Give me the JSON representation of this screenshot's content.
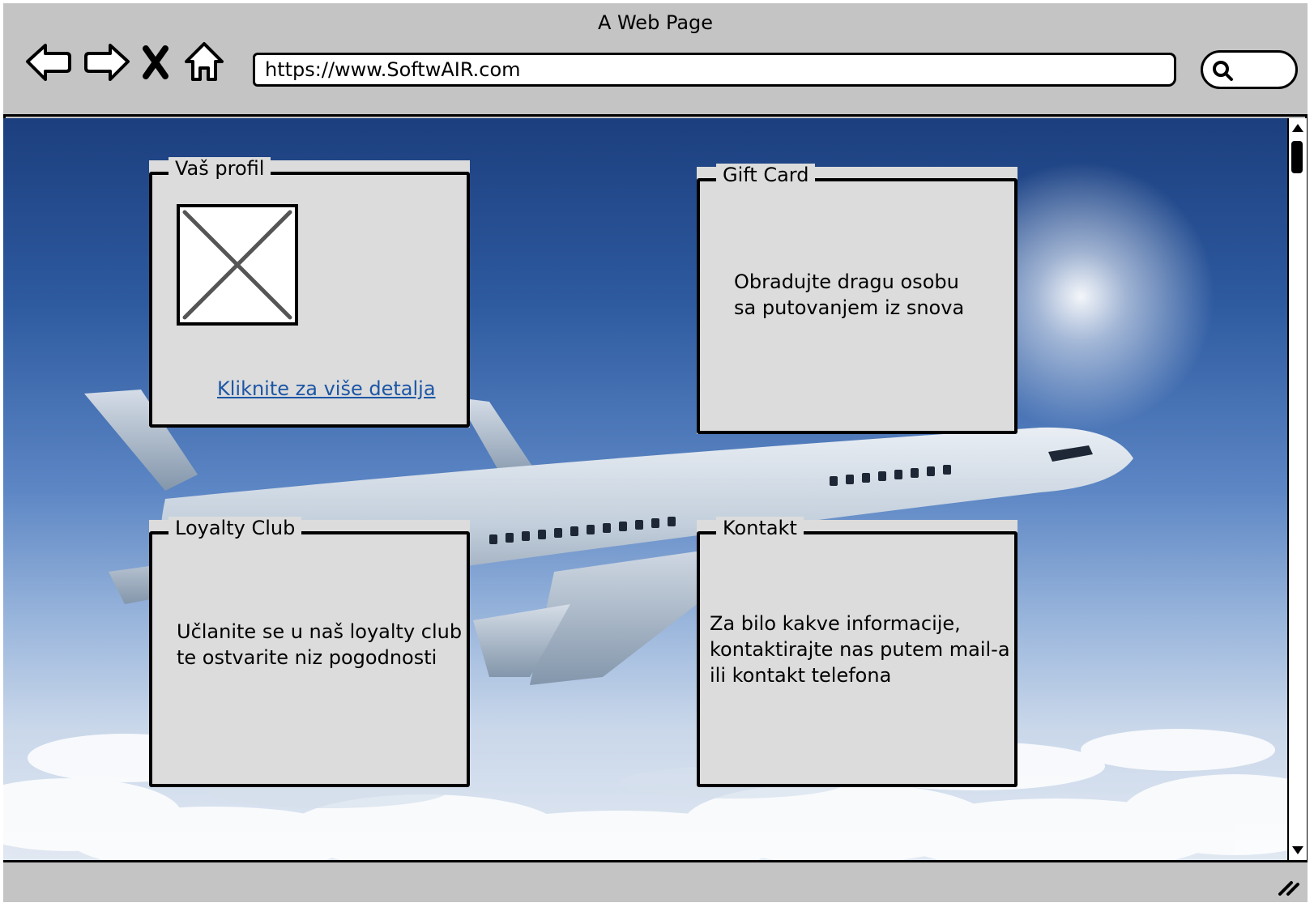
{
  "window": {
    "title": "A Web Page"
  },
  "toolbar": {
    "back_icon": "back-arrow-icon",
    "forward_icon": "forward-arrow-icon",
    "stop_icon": "close-icon",
    "home_icon": "home-icon",
    "search_icon": "search-icon"
  },
  "address_bar": {
    "url": "https://www.SoftwAIR.com"
  },
  "panels": {
    "profile": {
      "title": "Vaš profil",
      "image_icon": "image-placeholder-icon",
      "link": "Kliknite za više detalja"
    },
    "gift_card": {
      "title": "Gift Card",
      "text": "Obradujte dragu osobu\n sa putovanjem iz snova"
    },
    "loyalty": {
      "title": "Loyalty Club",
      "text": "Učlanite se u naš loyalty club\nte ostvarite niz pogodnosti"
    },
    "contact": {
      "title": "Kontakt",
      "text": "Za bilo kakve informacije,\nkontaktirajte nas putem mail-a\nili kontakt telefona"
    }
  },
  "colors": {
    "chrome": "#c4c4c4",
    "panel": "#dcdcdc",
    "link": "#1c56a5",
    "sky_top": "#1c3f7e",
    "sky_bottom": "#e1e8f2"
  }
}
